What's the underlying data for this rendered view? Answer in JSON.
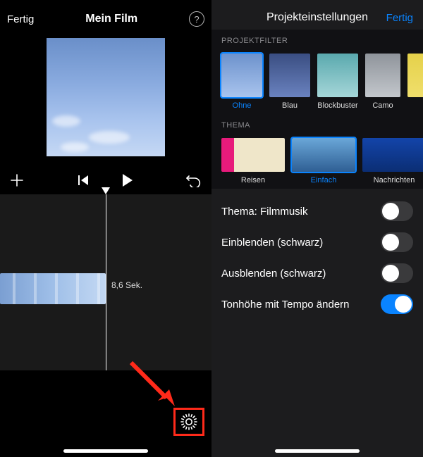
{
  "left": {
    "done": "Fertig",
    "title": "Mein Film",
    "help_glyph": "?",
    "duration": "8,6 Sek."
  },
  "right": {
    "title": "Projekteinstellungen",
    "done": "Fertig",
    "section_filter": "PROJEKTFILTER",
    "section_theme": "THEMA",
    "filters": [
      {
        "label": "Ohne",
        "selected": true
      },
      {
        "label": "Blau",
        "selected": false
      },
      {
        "label": "Blockbuster",
        "selected": false
      },
      {
        "label": "Camo",
        "selected": false
      },
      {
        "label": "",
        "selected": false
      }
    ],
    "themes": [
      {
        "label": "Reisen",
        "selected": false
      },
      {
        "label": "Einfach",
        "selected": true
      },
      {
        "label": "Nachrichten",
        "selected": false
      }
    ],
    "settings": [
      {
        "label": "Thema: Filmmusik",
        "on": false
      },
      {
        "label": "Einblenden (schwarz)",
        "on": false
      },
      {
        "label": "Ausblenden (schwarz)",
        "on": false
      },
      {
        "label": "Tonhöhe mit Tempo ändern",
        "on": true
      }
    ]
  },
  "colors": {
    "accent": "#0a84ff",
    "annotation": "#ff2a1a"
  }
}
